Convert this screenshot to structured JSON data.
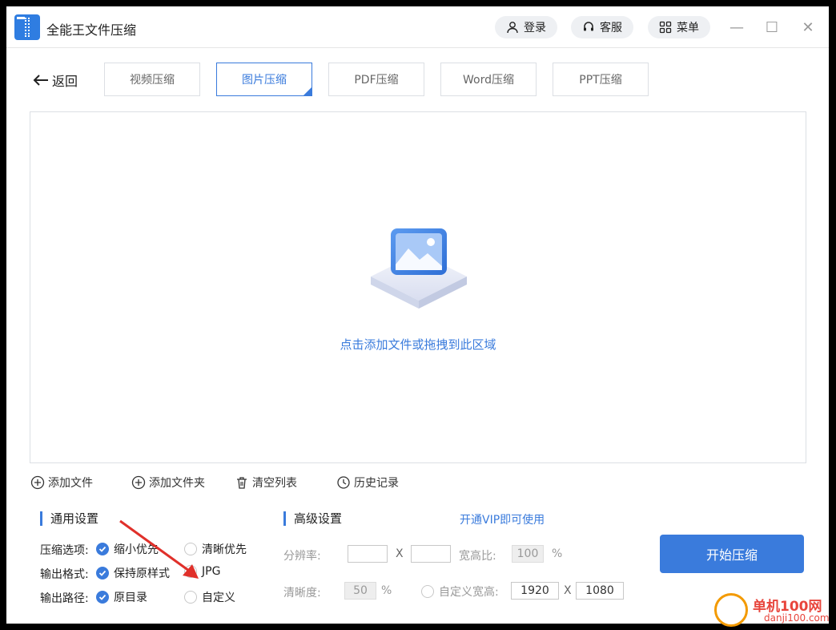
{
  "app": {
    "title": "全能王文件压缩"
  },
  "header": {
    "login": "登录",
    "support": "客服",
    "menu": "菜单"
  },
  "window_controls": {
    "minimize": "—",
    "maximize": "☐",
    "close": "✕"
  },
  "nav": {
    "back": "返回"
  },
  "tabs": [
    {
      "label": "视频压缩",
      "active": false
    },
    {
      "label": "图片压缩",
      "active": true
    },
    {
      "label": "PDF压缩",
      "active": false
    },
    {
      "label": "Word压缩",
      "active": false
    },
    {
      "label": "PPT压缩",
      "active": false
    }
  ],
  "dropzone": {
    "hint": "点击添加文件或拖拽到此区域"
  },
  "actions": {
    "add_file": "添加文件",
    "add_folder": "添加文件夹",
    "clear_list": "清空列表",
    "history": "历史记录"
  },
  "general": {
    "title": "通用设置",
    "compress_label": "压缩选项:",
    "compress_opt1": "缩小优先",
    "compress_opt2": "清晰优先",
    "format_label": "输出格式:",
    "format_opt1": "保持原样式",
    "format_opt2": "JPG",
    "path_label": "输出路径:",
    "path_opt1": "原目录",
    "path_opt2": "自定义"
  },
  "advanced": {
    "title": "高级设置",
    "vip_link": "开通VIP即可使用",
    "resolution_label": "分辨率:",
    "x_sep": "X",
    "ratio_label": "宽高比:",
    "ratio_value": "100",
    "percent": "%",
    "clarity_label": "清晰度:",
    "clarity_value": "50",
    "custom_size_label": "自定义宽高:",
    "custom_width": "1920",
    "custom_height": "1080"
  },
  "start_button": "开始压缩",
  "watermark": {
    "text": "单机100网",
    "sub": "danji100.com"
  },
  "colors": {
    "accent": "#3a7bdc",
    "annotation": "#e0302a"
  }
}
